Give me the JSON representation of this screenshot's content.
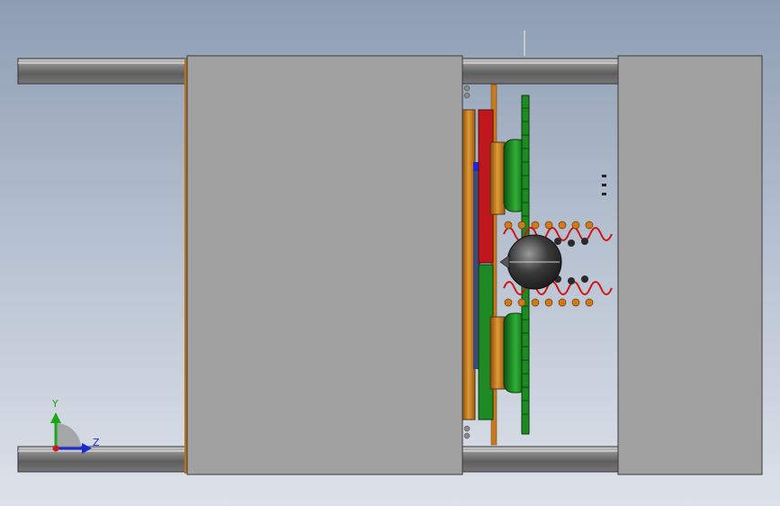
{
  "viewport": {
    "description_visible": false,
    "triad": {
      "y_label": "Y",
      "z_label": "Z"
    },
    "colors": {
      "plate": "#a1a1a1",
      "rail": "#6f6f6f",
      "rail_highlight": "#bdbdbd",
      "copper": "#c77a1f",
      "red": "#c0171f",
      "green": "#1f8a25",
      "dark_green": "#0e5a12",
      "sphere": "#3d3d3d",
      "spring": "#d01515",
      "axis_y": "#18a818",
      "axis_z": "#1a2bd6",
      "axis_x": "#d01818"
    }
  }
}
